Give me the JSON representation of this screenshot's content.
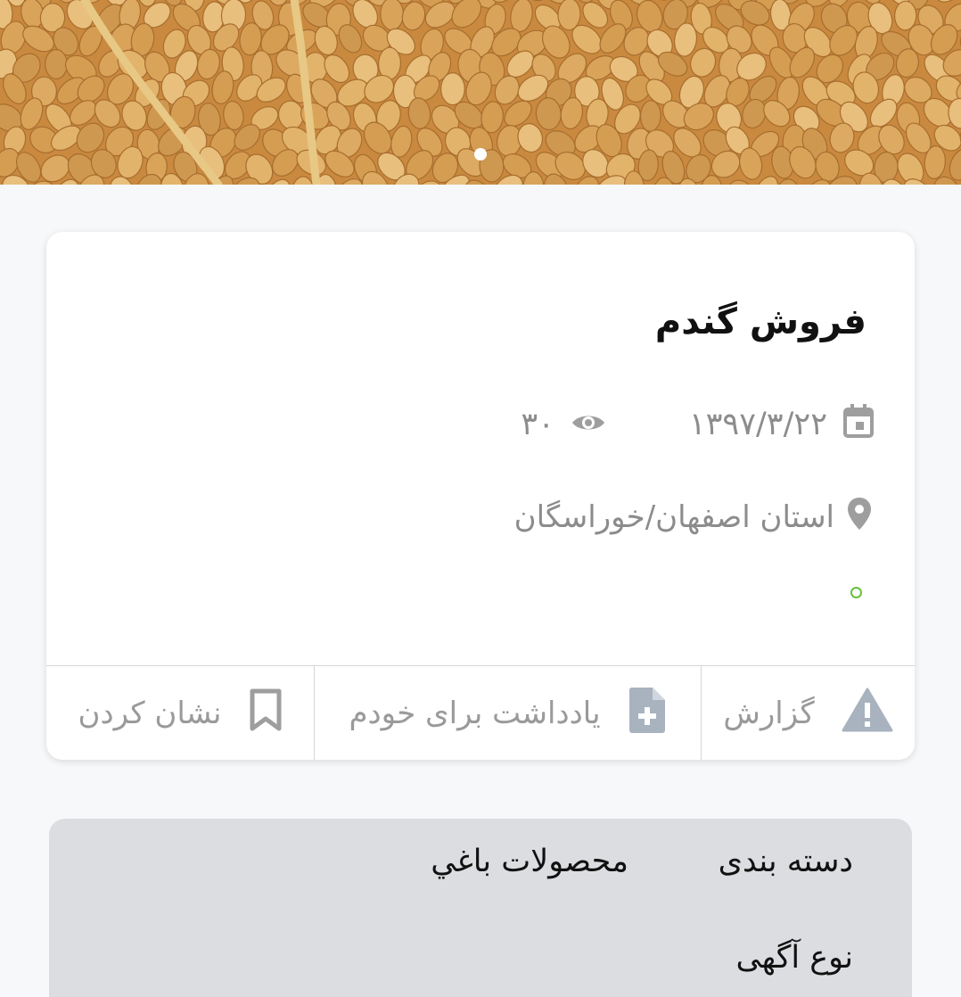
{
  "hero": {
    "image_alt": "wheat grains",
    "pager_dots": 1
  },
  "listing": {
    "title": "فروش گندم",
    "date": "۱۳۹۷/۳/۲۲",
    "views": "۳۰",
    "location": "استان اصفهان/خوراسگان",
    "status_color": "#67c23a"
  },
  "actions": {
    "report_label": "گزارش",
    "note_label": "یادداشت برای خودم",
    "bookmark_label": "نشان کردن"
  },
  "details": {
    "category_label": "دسته بندی",
    "category_value": "محصولات باغي",
    "type_label": "نوع آگهی"
  },
  "icons": {
    "date": "calendar-icon",
    "views": "eye-icon",
    "location": "map-pin-icon",
    "report": "warning-icon",
    "note": "note-add-icon",
    "bookmark": "bookmark-icon"
  },
  "colors": {
    "icon_gray": "#9e9e9e",
    "note_icon": "#a9b3bf",
    "warning_icon": "#a9b3bf",
    "status_green": "#67c23a"
  }
}
